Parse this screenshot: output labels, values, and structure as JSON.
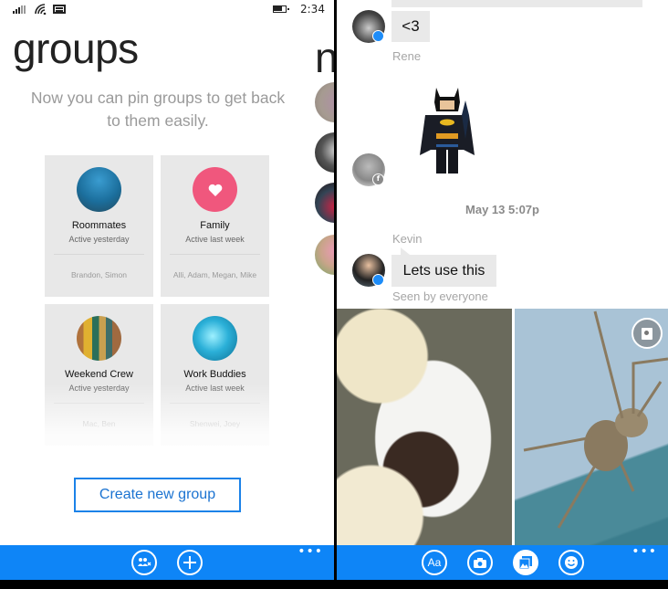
{
  "left_screen": {
    "status_bar": {
      "time": "2:34",
      "icons": [
        "signal-icon",
        "wifi-icon",
        "message-icon",
        "battery-icon"
      ]
    },
    "title": "groups",
    "next_pivot_peek": "n",
    "intro_text": "Now you can pin groups to get back to them easily.",
    "groups": [
      {
        "name": "Roommates",
        "activity": "Active yesterday",
        "members": "Brandon, Simon",
        "avatar": "city-night-image"
      },
      {
        "name": "Family",
        "activity": "Active last week",
        "members": "Alli, Adam, Megan, Mike",
        "avatar": "heart-icon"
      },
      {
        "name": "Weekend Crew",
        "activity": "Active yesterday",
        "members": "Mac, Ben",
        "avatar": "surfboards-image"
      },
      {
        "name": "Work Buddies",
        "activity": "Active last week",
        "members": "Shenwei, Joey",
        "avatar": "blue-sphere-image"
      }
    ],
    "create_button": "Create new group",
    "app_bar": {
      "buttons": [
        "new-group-icon",
        "add-icon"
      ],
      "more": "•••"
    }
  },
  "right_screen": {
    "messages": [
      {
        "sender": "Rene",
        "text": "<3",
        "source": "messenger"
      },
      {
        "sticker": "lego-batman-sticker",
        "source": "facebook"
      }
    ],
    "timestamp": "May 13 5:07p",
    "kevin_message": {
      "sender": "Kevin",
      "text": "Lets use this",
      "status": "Seen by everyone",
      "source": "messenger"
    },
    "photos": [
      "dessert-photo",
      "spider-photo"
    ],
    "app_bar": {
      "buttons": [
        {
          "label": "Aa",
          "name": "text-format-icon"
        },
        {
          "name": "camera-icon"
        },
        {
          "name": "photos-icon",
          "active": true
        },
        {
          "name": "emoji-icon"
        }
      ],
      "more": "•••"
    }
  },
  "colors": {
    "accent": "#0e85f7",
    "button_border": "#1b82e8",
    "tile_bg": "#e8e8e8",
    "bubble_bg": "#e9e9e9",
    "family_pink": "#f0577d"
  }
}
